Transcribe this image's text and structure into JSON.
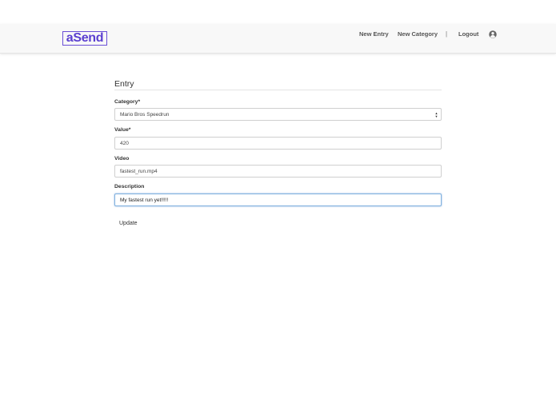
{
  "brand": {
    "logo_text": "aSend",
    "color": "#5b3fd0"
  },
  "nav": {
    "new_entry": "New Entry",
    "new_category": "New Category",
    "separator": "|",
    "logout": "Logout",
    "user_icon": "user-circle-icon"
  },
  "form": {
    "title": "Entry",
    "category": {
      "label": "Category*",
      "value": "Mario Bros Speedrun"
    },
    "value": {
      "label": "Value*",
      "value": "420"
    },
    "video": {
      "label": "Video",
      "value": "fastest_run.mp4"
    },
    "description": {
      "label": "Description",
      "value": "My fastest run yet!!!!!"
    },
    "submit_label": "Update"
  }
}
